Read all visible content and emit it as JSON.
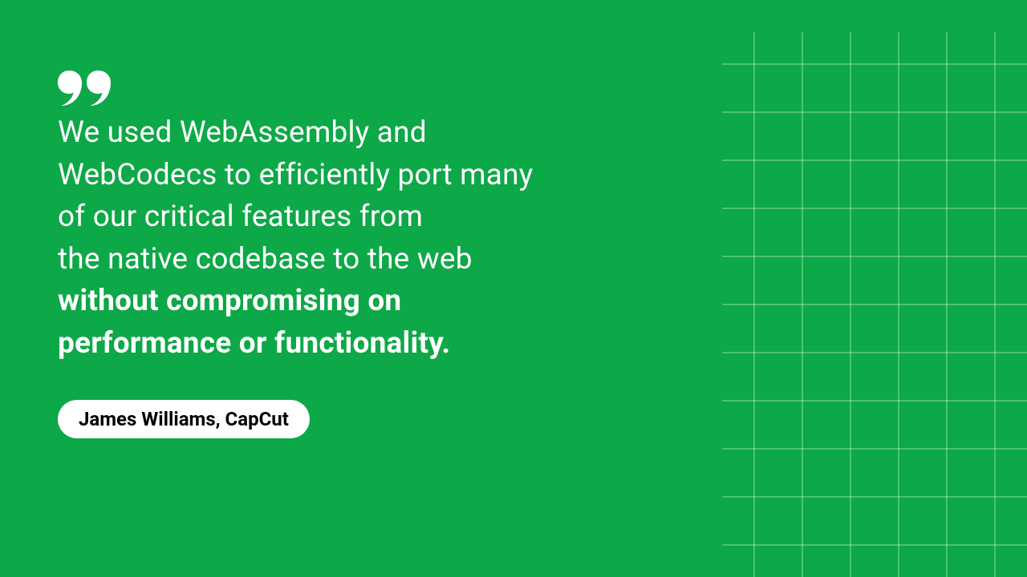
{
  "quote": {
    "line1": "We used WebAssembly and",
    "line2": "WebCodecs to efficiently port many",
    "line3": "of our critical features from",
    "line4": "the native codebase to the web",
    "bold_line1": "without compromising on",
    "bold_line2": "performance or functionality."
  },
  "attribution": "James Williams, CapCut",
  "colors": {
    "background": "#0DA847",
    "text": "#ffffff",
    "pill_bg": "#ffffff",
    "pill_text": "#000000"
  }
}
